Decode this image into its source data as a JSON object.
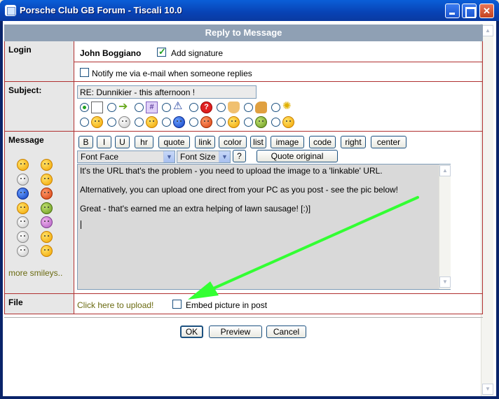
{
  "window": {
    "title": "Porsche Club GB Forum - Tiscali 10.0"
  },
  "form": {
    "header": "Reply to Message",
    "login": {
      "label": "Login",
      "username": "John Boggiano",
      "add_signature_label": "Add signature",
      "add_signature_checked": true,
      "notify_label": "Notify me via e-mail when someone replies",
      "notify_checked": false
    },
    "subject": {
      "label": "Subject:",
      "value": "RE: Dunnikier - this afternoon !"
    },
    "message": {
      "label": "Message",
      "more_smileys": "more smileys..",
      "buttons": [
        "B",
        "I",
        "U",
        "hr",
        "quote",
        "link",
        "color",
        "list",
        "image",
        "code",
        "right",
        "center"
      ],
      "font_face": "Font Face",
      "font_size": "Font Size",
      "help": "?",
      "quote_original": "Quote original",
      "lines": [
        "It's the URL that's the problem - you need to upload the image to a 'linkable' URL.",
        "Alternatively, you can upload one direct from your PC as you post - see the pic below!",
        "Great - that's earned me an extra helping of lawn sausage!  [:)]"
      ]
    },
    "file": {
      "label": "File",
      "upload_link": "Click here to upload!",
      "embed_label": "Embed picture in post",
      "embed_checked": false
    },
    "footer": {
      "ok": "OK",
      "preview": "Preview",
      "cancel": "Cancel"
    }
  },
  "icons": {
    "subject_row1": [
      "document-icon",
      "arrow-icon",
      "hash-icon",
      "warning-icon",
      "question-icon",
      "thumbs-down-icon",
      "thumbs-up-icon",
      "lightbulb-icon"
    ],
    "subject_row2": [
      "smiley-icon",
      "sunglasses-icon",
      "wink-icon",
      "blue-smiley-icon",
      "angry-icon",
      "sleepy-icon",
      "sick-icon",
      "tongue-icon"
    ],
    "selected_subject_icon": 0
  },
  "annotation": {
    "arrow_color": "#33ff33"
  }
}
